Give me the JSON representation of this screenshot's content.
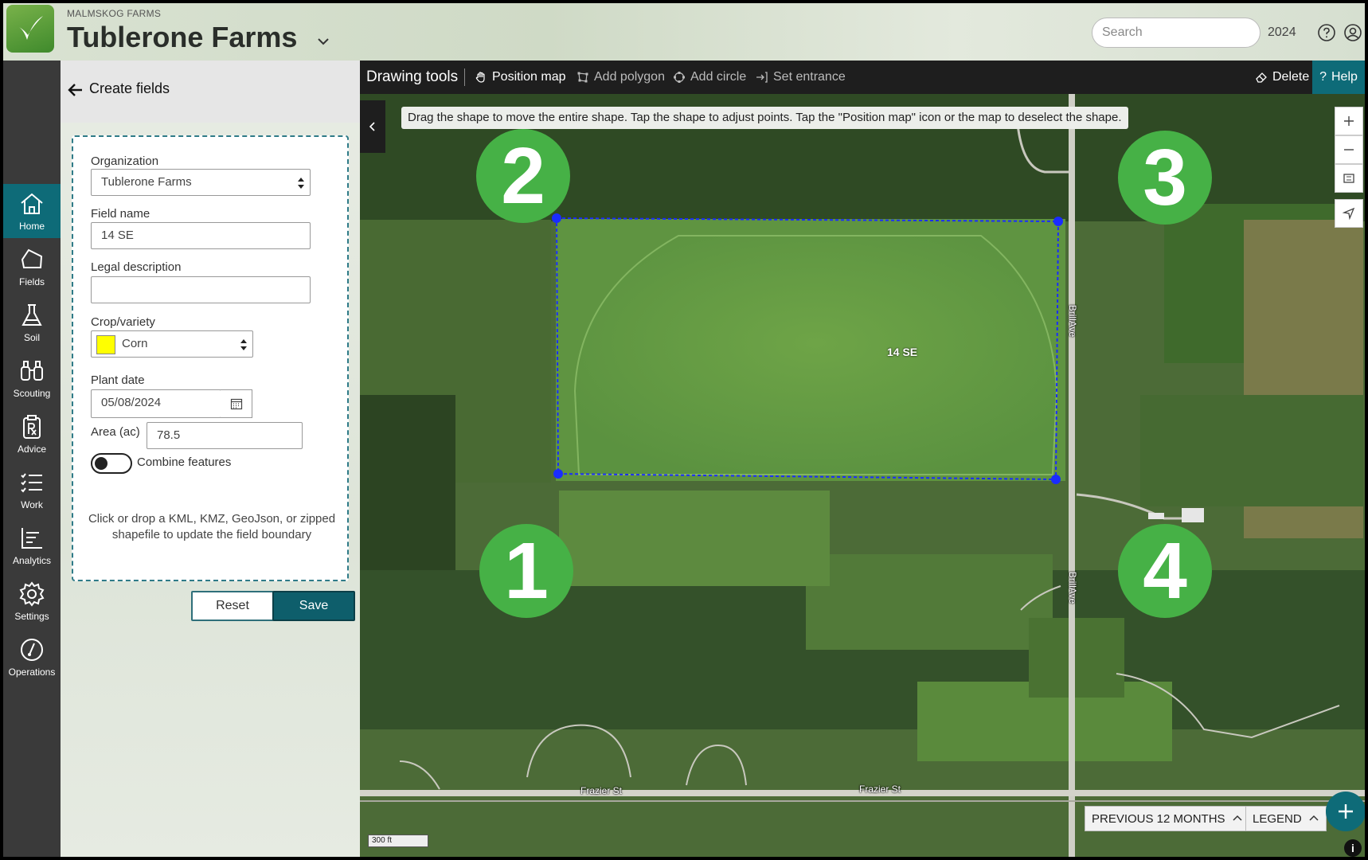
{
  "header": {
    "org_small": "MALMSKOG FARMS",
    "farm_name": "Tublerone Farms",
    "search_placeholder": "Search",
    "year": "2024"
  },
  "nav": {
    "items": [
      {
        "label": "Home",
        "icon": "home-icon"
      },
      {
        "label": "Fields",
        "icon": "fields-icon"
      },
      {
        "label": "Soil",
        "icon": "flask-icon"
      },
      {
        "label": "Scouting",
        "icon": "binoculars-icon"
      },
      {
        "label": "Advice",
        "icon": "prescription-icon"
      },
      {
        "label": "Work",
        "icon": "checklist-icon"
      },
      {
        "label": "Analytics",
        "icon": "chart-icon"
      },
      {
        "label": "Settings",
        "icon": "gear-icon"
      },
      {
        "label": "Operations",
        "icon": "gauge-icon"
      }
    ],
    "active": "Home"
  },
  "panel": {
    "title": "Create fields",
    "organization_label": "Organization",
    "organization_value": "Tublerone Farms",
    "field_name_label": "Field name",
    "field_name_value": "14 SE",
    "legal_label": "Legal description",
    "legal_value": "",
    "crop_label": "Crop/variety",
    "crop_value": "Corn",
    "crop_color": "#ffff00",
    "plant_date_label": "Plant date",
    "plant_date_value": "05/08/2024",
    "area_label": "Area (ac)",
    "area_value": "78.5",
    "combine_label": "Combine features",
    "combine_on": false,
    "drop_hint": "Click or drop a KML, KMZ, GeoJson, or zipped shapefile to update the field boundary",
    "reset_label": "Reset",
    "save_label": "Save"
  },
  "toolbar": {
    "title": "Drawing tools",
    "tools": [
      {
        "label": "Position map",
        "active": true
      },
      {
        "label": "Add polygon",
        "active": false
      },
      {
        "label": "Add circle",
        "active": false
      },
      {
        "label": "Set entrance",
        "active": false
      }
    ],
    "delete_label": "Delete",
    "help_label": "Help"
  },
  "map": {
    "hint": "Drag the shape to move the entire shape. Tap the shape to adjust points. Tap the \"Position map\" icon or the map to deselect the shape.",
    "field_label": "14 SE",
    "road_labels": [
      "BrillAve",
      "BrillAve",
      "Frazier St",
      "Frazier St"
    ],
    "scale_label": "300 ft",
    "previous_label": "PREVIOUS 12 MONTHS",
    "legend_label": "LEGEND",
    "callouts": [
      "1",
      "2",
      "3",
      "4"
    ],
    "accent_color": "#0e6b78",
    "boundary_color": "#1a2cff",
    "callout_color": "#46b146"
  }
}
